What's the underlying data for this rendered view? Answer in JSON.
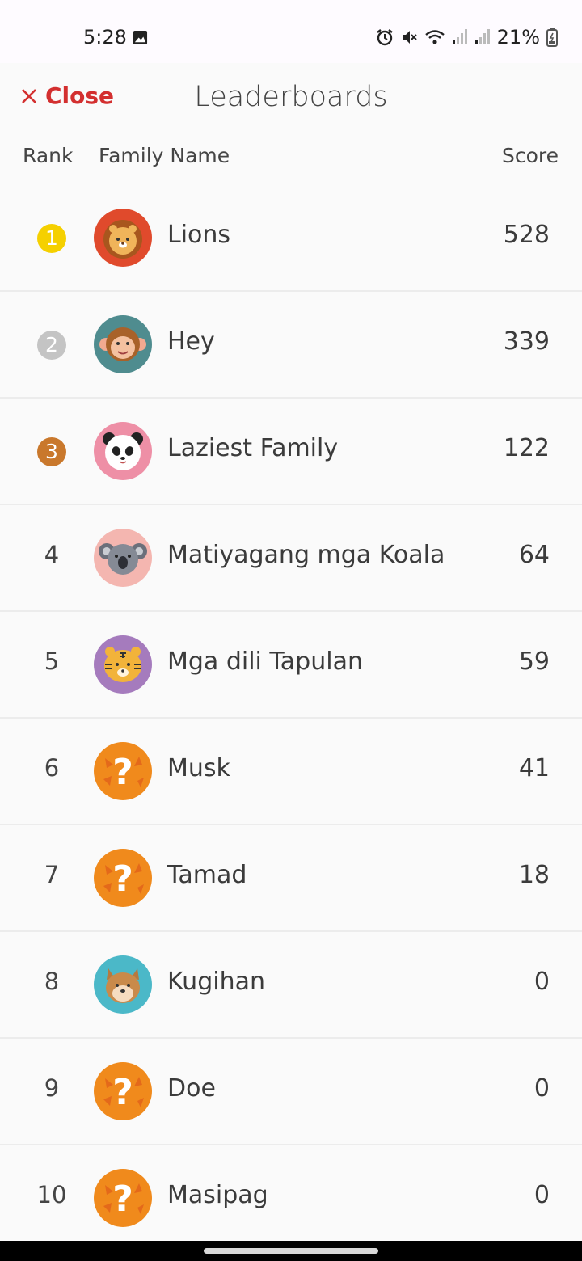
{
  "status_bar": {
    "time": "5:28",
    "battery": "21%",
    "icons": [
      "gallery-icon",
      "alarm-icon",
      "mute-icon",
      "wifi-icon",
      "signal-icon",
      "signal-icon",
      "battery-icon"
    ]
  },
  "header": {
    "close_label": "Close",
    "title": "Leaderboards",
    "close_color": "#d32f2f"
  },
  "columns": {
    "rank": "Rank",
    "family_name": "Family Name",
    "score": "Score"
  },
  "medal_colors": {
    "1": "#f5d000",
    "2": "#c4c4c4",
    "3": "#c9782c"
  },
  "rows": [
    {
      "rank": "1",
      "name": "Lions",
      "score": "528",
      "avatar": "lion-icon"
    },
    {
      "rank": "2",
      "name": "Hey",
      "score": "339",
      "avatar": "monkey-icon"
    },
    {
      "rank": "3",
      "name": "Laziest Family",
      "score": "122",
      "avatar": "panda-icon"
    },
    {
      "rank": "4",
      "name": "Matiyagang mga Koala",
      "score": "64",
      "avatar": "koala-icon"
    },
    {
      "rank": "5",
      "name": "Mga dili Tapulan",
      "score": "59",
      "avatar": "tiger-icon"
    },
    {
      "rank": "6",
      "name": "Musk",
      "score": "41",
      "avatar": "question-mark-icon"
    },
    {
      "rank": "7",
      "name": "Tamad",
      "score": "18",
      "avatar": "question-mark-icon"
    },
    {
      "rank": "8",
      "name": "Kugihan",
      "score": "0",
      "avatar": "shiba-dog-icon"
    },
    {
      "rank": "9",
      "name": "Doe",
      "score": "0",
      "avatar": "question-mark-icon"
    },
    {
      "rank": "10",
      "name": "Masipag",
      "score": "0",
      "avatar": "question-mark-icon"
    }
  ]
}
